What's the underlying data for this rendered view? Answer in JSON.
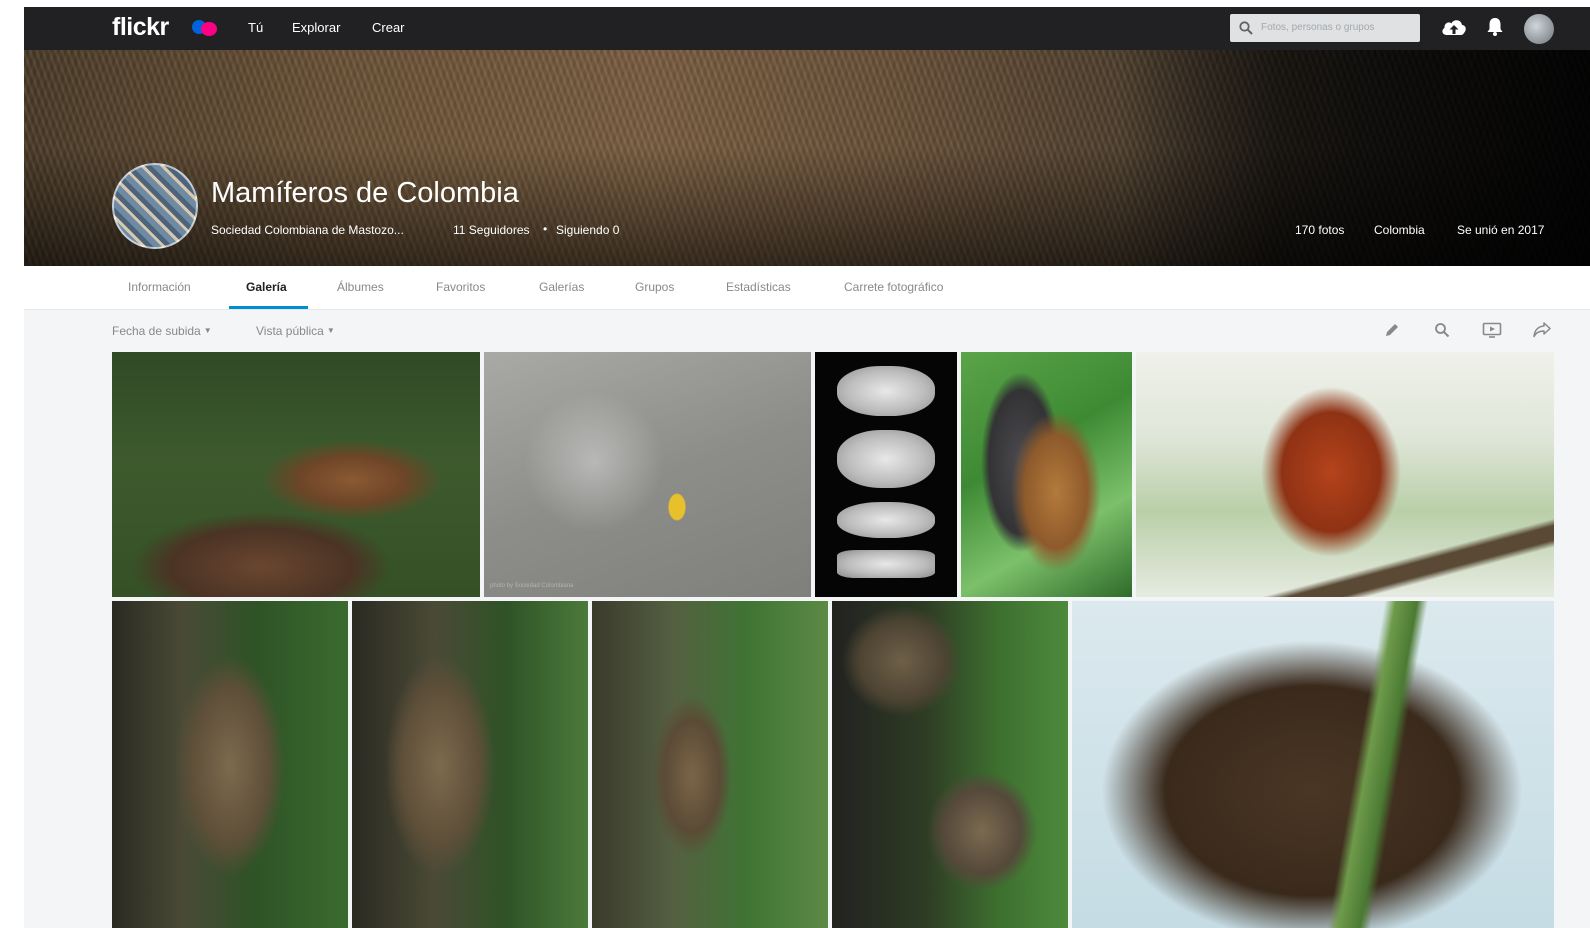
{
  "header": {
    "logo": "flickr",
    "nav": [
      "Tú",
      "Explorar",
      "Crear"
    ],
    "search_placeholder": "Fotos, personas o grupos"
  },
  "profile": {
    "name": "Mamíferos de Colombia",
    "subtitle": "Sociedad Colombiana de Mastozo...",
    "followers": "11 Seguidores",
    "separator": "•",
    "following": "Siguiendo 0",
    "photos": "170 fotos",
    "location": "Colombia",
    "joined": "Se unió en 2017"
  },
  "tabs": [
    "Información",
    "Galería",
    "Álbumes",
    "Favoritos",
    "Galerías",
    "Grupos",
    "Estadísticas",
    "Carrete fotográfico"
  ],
  "active_tab": "Galería",
  "toolbar": {
    "sort": "Fecha de subida",
    "view": "Vista pública",
    "icons": [
      "pencil-icon",
      "search-icon",
      "slideshow-icon",
      "share-icon"
    ]
  },
  "photos": [
    {
      "subject": "olingo-in-water"
    },
    {
      "subject": "tracks-in-sand",
      "caption": "photo by Sociedad Colombiana"
    },
    {
      "subject": "skull-specimens"
    },
    {
      "subject": "hanging-bat"
    },
    {
      "subject": "red-squirrel"
    },
    {
      "subject": "kinkajou-1"
    },
    {
      "subject": "kinkajou-2"
    },
    {
      "subject": "kinkajou-3"
    },
    {
      "subject": "kinkajou-4"
    },
    {
      "subject": "coati-on-branch"
    }
  ],
  "colors": {
    "topbar": "#212124",
    "accent": "#008ecf",
    "flickr_blue": "#0063dc",
    "flickr_pink": "#ff0084"
  }
}
